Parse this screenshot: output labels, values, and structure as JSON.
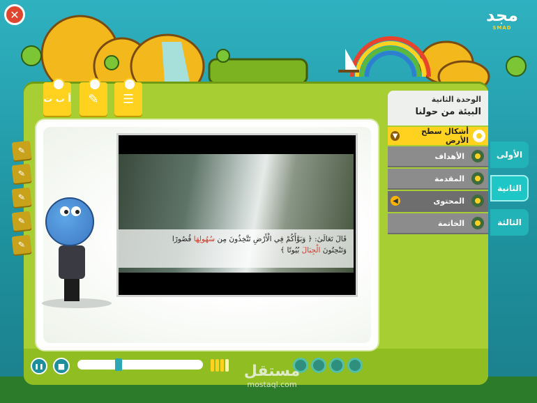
{
  "header": {
    "close_label": "✕",
    "logo_text": "مجد",
    "logo_sub": "SMAD"
  },
  "lesson": {
    "unit_label": "الوحدة الثانية",
    "title": "البيئة من حولنا",
    "topic": "أشكال سطح الأرض"
  },
  "menu": {
    "items": [
      {
        "label": "الأهداف",
        "icon": "flower-icon",
        "active": false
      },
      {
        "label": "المقدمة",
        "icon": "flower-icon",
        "active": false
      },
      {
        "label": "المحتوى",
        "icon": "flower-icon",
        "active": true
      },
      {
        "label": "الخاتمة",
        "icon": "flower-icon",
        "active": false
      }
    ]
  },
  "tabs": [
    {
      "label": "الأولى"
    },
    {
      "label": "الثانية"
    },
    {
      "label": "الثالثة"
    }
  ],
  "top_icons": [
    {
      "name": "alphabet-icon",
      "glyph": "أ ب ت"
    },
    {
      "name": "pen-icon",
      "glyph": "✎"
    },
    {
      "name": "notes-icon",
      "glyph": "☰"
    }
  ],
  "video": {
    "subtitle_line1_pre": "قَالَ تَعَالَىٰ: ﴿ وَبَوَّأَكُمْ فِي الْأَرْضِ تَتَّخِذُونَ مِن ",
    "subtitle_highlight1": "سُهُولِهَا",
    "subtitle_line1_post": " قُصُورًا",
    "subtitle_line2_pre": "وَتَنْحِتُونَ ",
    "subtitle_highlight2": "الْجِبَالَ",
    "subtitle_line2_post": " بُيُوتًا ﴾"
  },
  "controls": {
    "play_pause": "❚❚",
    "stop": "■",
    "progress": 0.32
  },
  "watermark": {
    "arabic": "مستقل",
    "latin": "mostaql.com"
  },
  "colors": {
    "board": "#a7cf34",
    "accent_yellow": "#ffd21f",
    "tab_teal": "#22b3b8",
    "menu_grey": "#8c8c8c"
  }
}
